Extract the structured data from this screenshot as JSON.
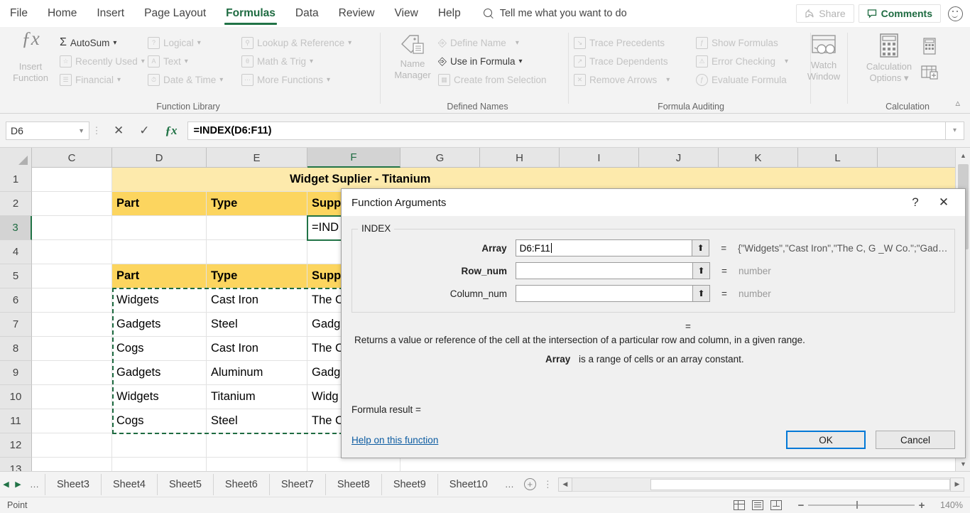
{
  "app": {
    "tabs": [
      "File",
      "Home",
      "Insert",
      "Page Layout",
      "Formulas",
      "Data",
      "Review",
      "View",
      "Help"
    ],
    "active_tab": "Formulas",
    "tell_me": "Tell me what you want to do",
    "share_label": "Share",
    "comments_label": "Comments"
  },
  "ribbon": {
    "groups": [
      {
        "name": "Function Library",
        "big_button": {
          "line1": "Insert",
          "line2": "Function",
          "icon": "fx-icon"
        },
        "items": [
          {
            "label": "AutoSum",
            "icon": "sigma-icon",
            "dropdown": true
          },
          {
            "label": "Recently Used",
            "icon": "recent-icon",
            "dropdown": true
          },
          {
            "label": "Financial",
            "icon": "financial-icon",
            "dropdown": true
          },
          {
            "label": "Logical",
            "icon": "logical-icon",
            "dropdown": true
          },
          {
            "label": "Text",
            "icon": "text-icon",
            "dropdown": true
          },
          {
            "label": "Date & Time",
            "icon": "clock-icon",
            "dropdown": true
          },
          {
            "label": "Lookup & Reference",
            "icon": "lookup-icon",
            "dropdown": true
          },
          {
            "label": "Math & Trig",
            "icon": "math-icon",
            "dropdown": true
          },
          {
            "label": "More Functions",
            "icon": "more-functions-icon",
            "dropdown": true
          }
        ]
      },
      {
        "name": "Defined Names",
        "big_button": {
          "line1": "Name",
          "line2": "Manager",
          "icon": "name-manager-icon"
        },
        "items": [
          {
            "label": "Define Name",
            "icon": "tag-icon",
            "dropdown": true
          },
          {
            "label": "Use in Formula",
            "icon": "use-in-formula-icon",
            "dropdown": true
          },
          {
            "label": "Create from Selection",
            "icon": "create-from-selection-icon",
            "dropdown": false
          }
        ]
      },
      {
        "name": "Formula Auditing",
        "big_button": {
          "line1": "Watch",
          "line2": "Window",
          "icon": "watch-window-icon"
        },
        "items": [
          {
            "label": "Trace Precedents",
            "icon": "trace-precedents-icon",
            "dropdown": false
          },
          {
            "label": "Trace Dependents",
            "icon": "trace-dependents-icon",
            "dropdown": false
          },
          {
            "label": "Remove Arrows",
            "icon": "remove-arrows-icon",
            "dropdown": true
          },
          {
            "label": "Show Formulas",
            "icon": "show-formulas-icon",
            "dropdown": false
          },
          {
            "label": "Error Checking",
            "icon": "error-checking-icon",
            "dropdown": true
          },
          {
            "label": "Evaluate Formula",
            "icon": "evaluate-formula-icon",
            "dropdown": false
          }
        ]
      },
      {
        "name": "Calculation",
        "big_button": {
          "line1": "Calculation",
          "line2": "Options",
          "icon": "calculator-icon"
        },
        "items": [
          {
            "label": "",
            "icon": "calculate-now-icon",
            "dropdown": false
          },
          {
            "label": "",
            "icon": "calculate-sheet-icon",
            "dropdown": false
          }
        ]
      }
    ]
  },
  "formula_bar": {
    "name_box": "D6",
    "formula": "=INDEX(D6:F11)",
    "cancel_icon": "cancel-icon",
    "enter_icon": "enter-icon",
    "insert_function_icon": "fx-icon"
  },
  "grid": {
    "columns": [
      "C",
      "D",
      "E",
      "F",
      "G",
      "H",
      "I",
      "J",
      "K",
      "L"
    ],
    "selected_column": "F",
    "rows": [
      "1",
      "2",
      "3",
      "4",
      "5",
      "6",
      "7",
      "8",
      "9",
      "10",
      "11",
      "12",
      "13"
    ],
    "selected_row": "3",
    "title_cell": "Widget Suplier - Titanium",
    "header_row_1": [
      "Part",
      "Type",
      "Supp"
    ],
    "header_row_2": [
      "Part",
      "Type",
      "Supp"
    ],
    "formula_cell": "=IND",
    "data": [
      {
        "row": "6",
        "part": "Widgets",
        "type": "Cast Iron",
        "supplier": "The C"
      },
      {
        "row": "7",
        "part": "Gadgets",
        "type": "Steel",
        "supplier": "Gadg"
      },
      {
        "row": "8",
        "part": "Cogs",
        "type": "Cast Iron",
        "supplier": "The C"
      },
      {
        "row": "9",
        "part": "Gadgets",
        "type": "Aluminum",
        "supplier": "Gadg"
      },
      {
        "row": "10",
        "part": "Widgets",
        "type": "Titanium",
        "supplier": "Widg"
      },
      {
        "row": "11",
        "part": "Cogs",
        "type": "Steel",
        "supplier": "The C"
      }
    ]
  },
  "dialog": {
    "title": "Function Arguments",
    "help_icon": "help-icon",
    "close_icon": "close-icon",
    "function_name": "INDEX",
    "args": [
      {
        "label": "Array",
        "required": true,
        "value": "D6:F11",
        "result": "{\"Widgets\",\"Cast Iron\",\"The C, G _W Co.\";\"Gad…",
        "placeholder_result": false
      },
      {
        "label": "Row_num",
        "required": true,
        "value": "",
        "result": "number",
        "placeholder_result": true
      },
      {
        "label": "Column_num",
        "required": false,
        "value": "",
        "result": "number",
        "placeholder_result": true
      }
    ],
    "eq_symbol": "=",
    "overall_result": "",
    "description": "Returns a value or reference of the cell at the intersection of a particular row and column, in a given range.",
    "arg_help_name": "Array",
    "arg_help_text": "is a range of cells or an array constant.",
    "formula_result_label": "Formula result =",
    "formula_result_value": "",
    "help_link": "Help on this function",
    "ok_label": "OK",
    "cancel_label": "Cancel",
    "collapse_icon": "collapse-dialog-icon"
  },
  "sheet_tabs": {
    "first_icon": "nav-previous-icon",
    "next_icon": "nav-next-icon",
    "left_ellipsis": "…",
    "tabs": [
      "Sheet3",
      "Sheet4",
      "Sheet5",
      "Sheet6",
      "Sheet7",
      "Sheet8",
      "Sheet9",
      "Sheet10"
    ],
    "right_ellipsis": "…",
    "add_sheet_icon": "add-sheet-icon",
    "menu_icon": "sheet-menu-icon"
  },
  "status_bar": {
    "mode": "Point",
    "views": [
      "normal-view-icon",
      "page-layout-icon",
      "page-break-icon"
    ],
    "zoom_out_icon": "zoom-out-icon",
    "zoom_in_icon": "zoom-in-icon",
    "zoom_level": "140%"
  },
  "colors": {
    "accent_green": "#217346",
    "header_yellow": "#fcd55f",
    "title_yellow": "#fdeaac",
    "focus_blue": "#0078d7"
  }
}
